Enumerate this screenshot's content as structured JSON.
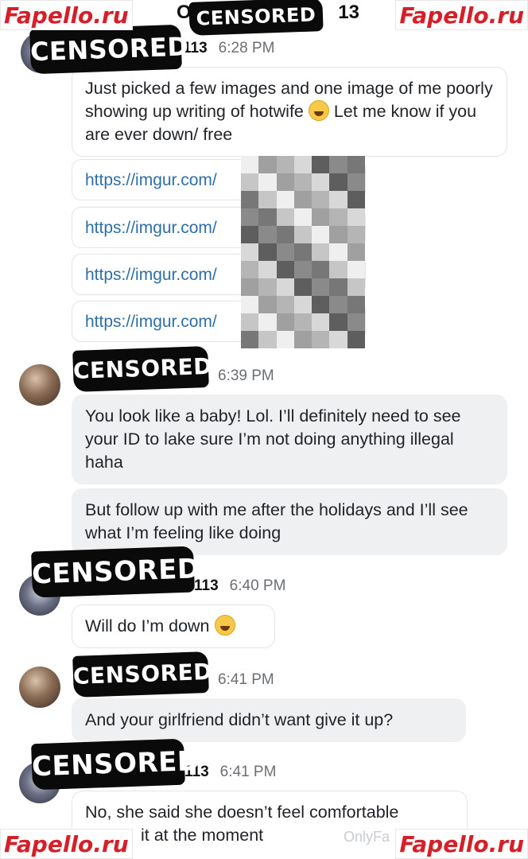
{
  "watermarks": {
    "top_left": "Fapello.ru",
    "top_right": "Fapello.ru",
    "bottom_left": "Fapello.ru",
    "bottom_right": "Fapello.ru",
    "footer": "OnlyFa"
  },
  "header": {
    "title_prefix": "O",
    "title_suffix": "13",
    "censor_label": "CENSORED"
  },
  "messages": [
    {
      "sender_censor": "CENSORED",
      "sender_suffix": "113",
      "time": "6:28 PM",
      "text": "Just picked a few images and one image of me poorly showing up writing of hotwife",
      "text_after_emoji": " Let me know if you are ever down/ free",
      "emoji": "laughing-face-emoji"
    },
    {
      "links": [
        "https://imgur.com/",
        "https://imgur.com/",
        "https://imgur.com/",
        "https://imgur.com/"
      ]
    },
    {
      "sender_censor": "CENSORED",
      "time": "6:39 PM",
      "text1": "You look like a baby! Lol. I’ll definitely need to see your ID to lake sure I’m not doing anything illegal haha",
      "text2": "But follow up with me after the holidays and I’ll see what I’m feeling like doing"
    },
    {
      "sender_censor": "CENSORED",
      "sender_suffix": "113",
      "time": "6:40 PM",
      "text": "Will do I’m down",
      "emoji": "sweat-smile-emoji"
    },
    {
      "sender_censor": "CENSORED",
      "time": "6:41 PM",
      "text": "And your girlfriend didn’t want give it up?"
    },
    {
      "sender_censor": "CENSORED",
      "sender_suffix": "113",
      "time": "6:41 PM",
      "text_line1": "No, she said she doesn’t feel comfortable",
      "text_line2": "it at the moment"
    }
  ],
  "colors": {
    "link": "#2f6fa7",
    "incoming_bubble": "#eef0f2",
    "watermark_red": "#d5202a"
  }
}
